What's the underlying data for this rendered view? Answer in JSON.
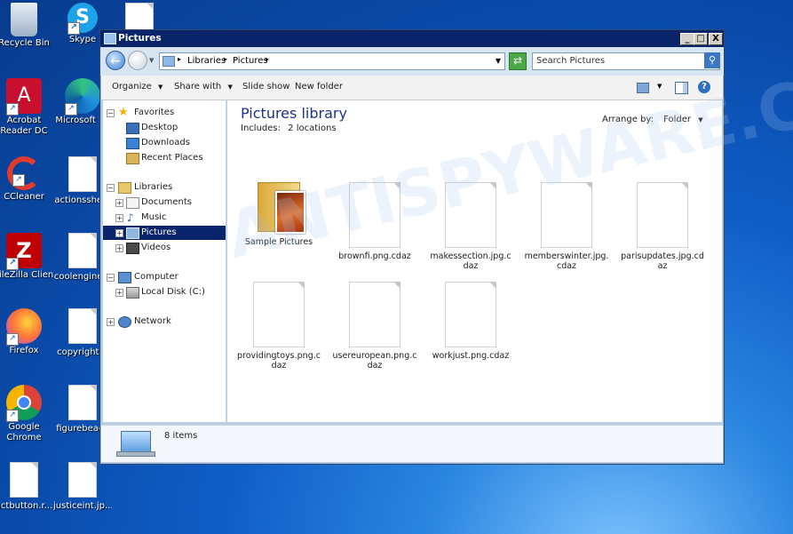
{
  "desktop": {
    "icons": [
      {
        "label": "Recycle Bin"
      },
      {
        "label": "Skype"
      },
      {
        "label": "Acrobat Reader DC"
      },
      {
        "label": "Microsoft Ed"
      },
      {
        "label": "CCleaner"
      },
      {
        "label": "actionsshe..."
      },
      {
        "label": "FileZilla Client"
      },
      {
        "label": "coolengine..."
      },
      {
        "label": "Firefox"
      },
      {
        "label": "copyrightgr"
      },
      {
        "label": "Google Chrome"
      },
      {
        "label": "figurebeach"
      },
      {
        "label": "actbutton.r..."
      },
      {
        "label": "justiceint.jp..."
      }
    ],
    "watermark": "ANTISPYWARE.CO"
  },
  "window": {
    "title": "Pictures",
    "controls": {
      "minimize": "_",
      "maximize": "□",
      "close": "X"
    },
    "address": {
      "crumb1": "Libraries",
      "crumb2": "Pictures",
      "sep": "▸"
    },
    "search": {
      "placeholder": "Search Pictures"
    },
    "toolbar": {
      "organize": "Organize",
      "share_with": "Share with",
      "slide_show": "Slide show",
      "new_folder": "New folder"
    },
    "nav": {
      "favorites": "Favorites",
      "desktop": "Desktop",
      "downloads": "Downloads",
      "recent": "Recent Places",
      "libraries": "Libraries",
      "documents": "Documents",
      "music": "Music",
      "pictures": "Pictures",
      "videos": "Videos",
      "computer": "Computer",
      "local_disk": "Local Disk (C:)",
      "network": "Network"
    },
    "content": {
      "title": "Pictures library",
      "includes_label": "Includes:",
      "includes_link": "2 locations",
      "arrange_label": "Arrange by:",
      "arrange_value": "Folder",
      "items": [
        {
          "name": "Sample Pictures",
          "kind": "folder"
        },
        {
          "name": "brownfi.png.cdaz",
          "kind": "file"
        },
        {
          "name": "makessection.jpg.cdaz",
          "kind": "file"
        },
        {
          "name": "memberswinter.jpg.cdaz",
          "kind": "file"
        },
        {
          "name": "parisupdates.jpg.cdaz",
          "kind": "file"
        },
        {
          "name": "providingtoys.png.cdaz",
          "kind": "file"
        },
        {
          "name": "usereuropean.png.cdaz",
          "kind": "file"
        },
        {
          "name": "workjust.png.cdaz",
          "kind": "file"
        }
      ]
    },
    "details": {
      "count": "8 items"
    }
  }
}
